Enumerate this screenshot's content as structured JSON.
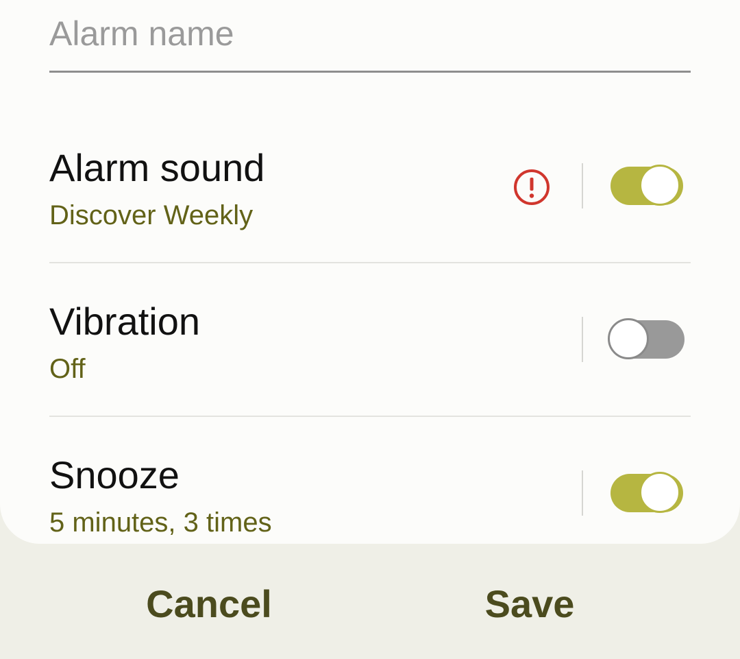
{
  "alarm_name": {
    "placeholder": "Alarm name",
    "value": ""
  },
  "settings": [
    {
      "title": "Alarm sound",
      "subtitle": "Discover Weekly",
      "enabled": true,
      "warning": true,
      "warning_icon": "exclamation-circle-icon"
    },
    {
      "title": "Vibration",
      "subtitle": "Off",
      "enabled": false,
      "warning": false
    },
    {
      "title": "Snooze",
      "subtitle": "5 minutes, 3 times",
      "enabled": true,
      "warning": false
    }
  ],
  "actions": {
    "cancel_label": "Cancel",
    "save_label": "Save"
  },
  "colors": {
    "accent": "#b6b641",
    "subtitle": "#626218",
    "warning": "#d0362d",
    "action_text": "#4b4b1e",
    "switch_off": "#999999"
  }
}
